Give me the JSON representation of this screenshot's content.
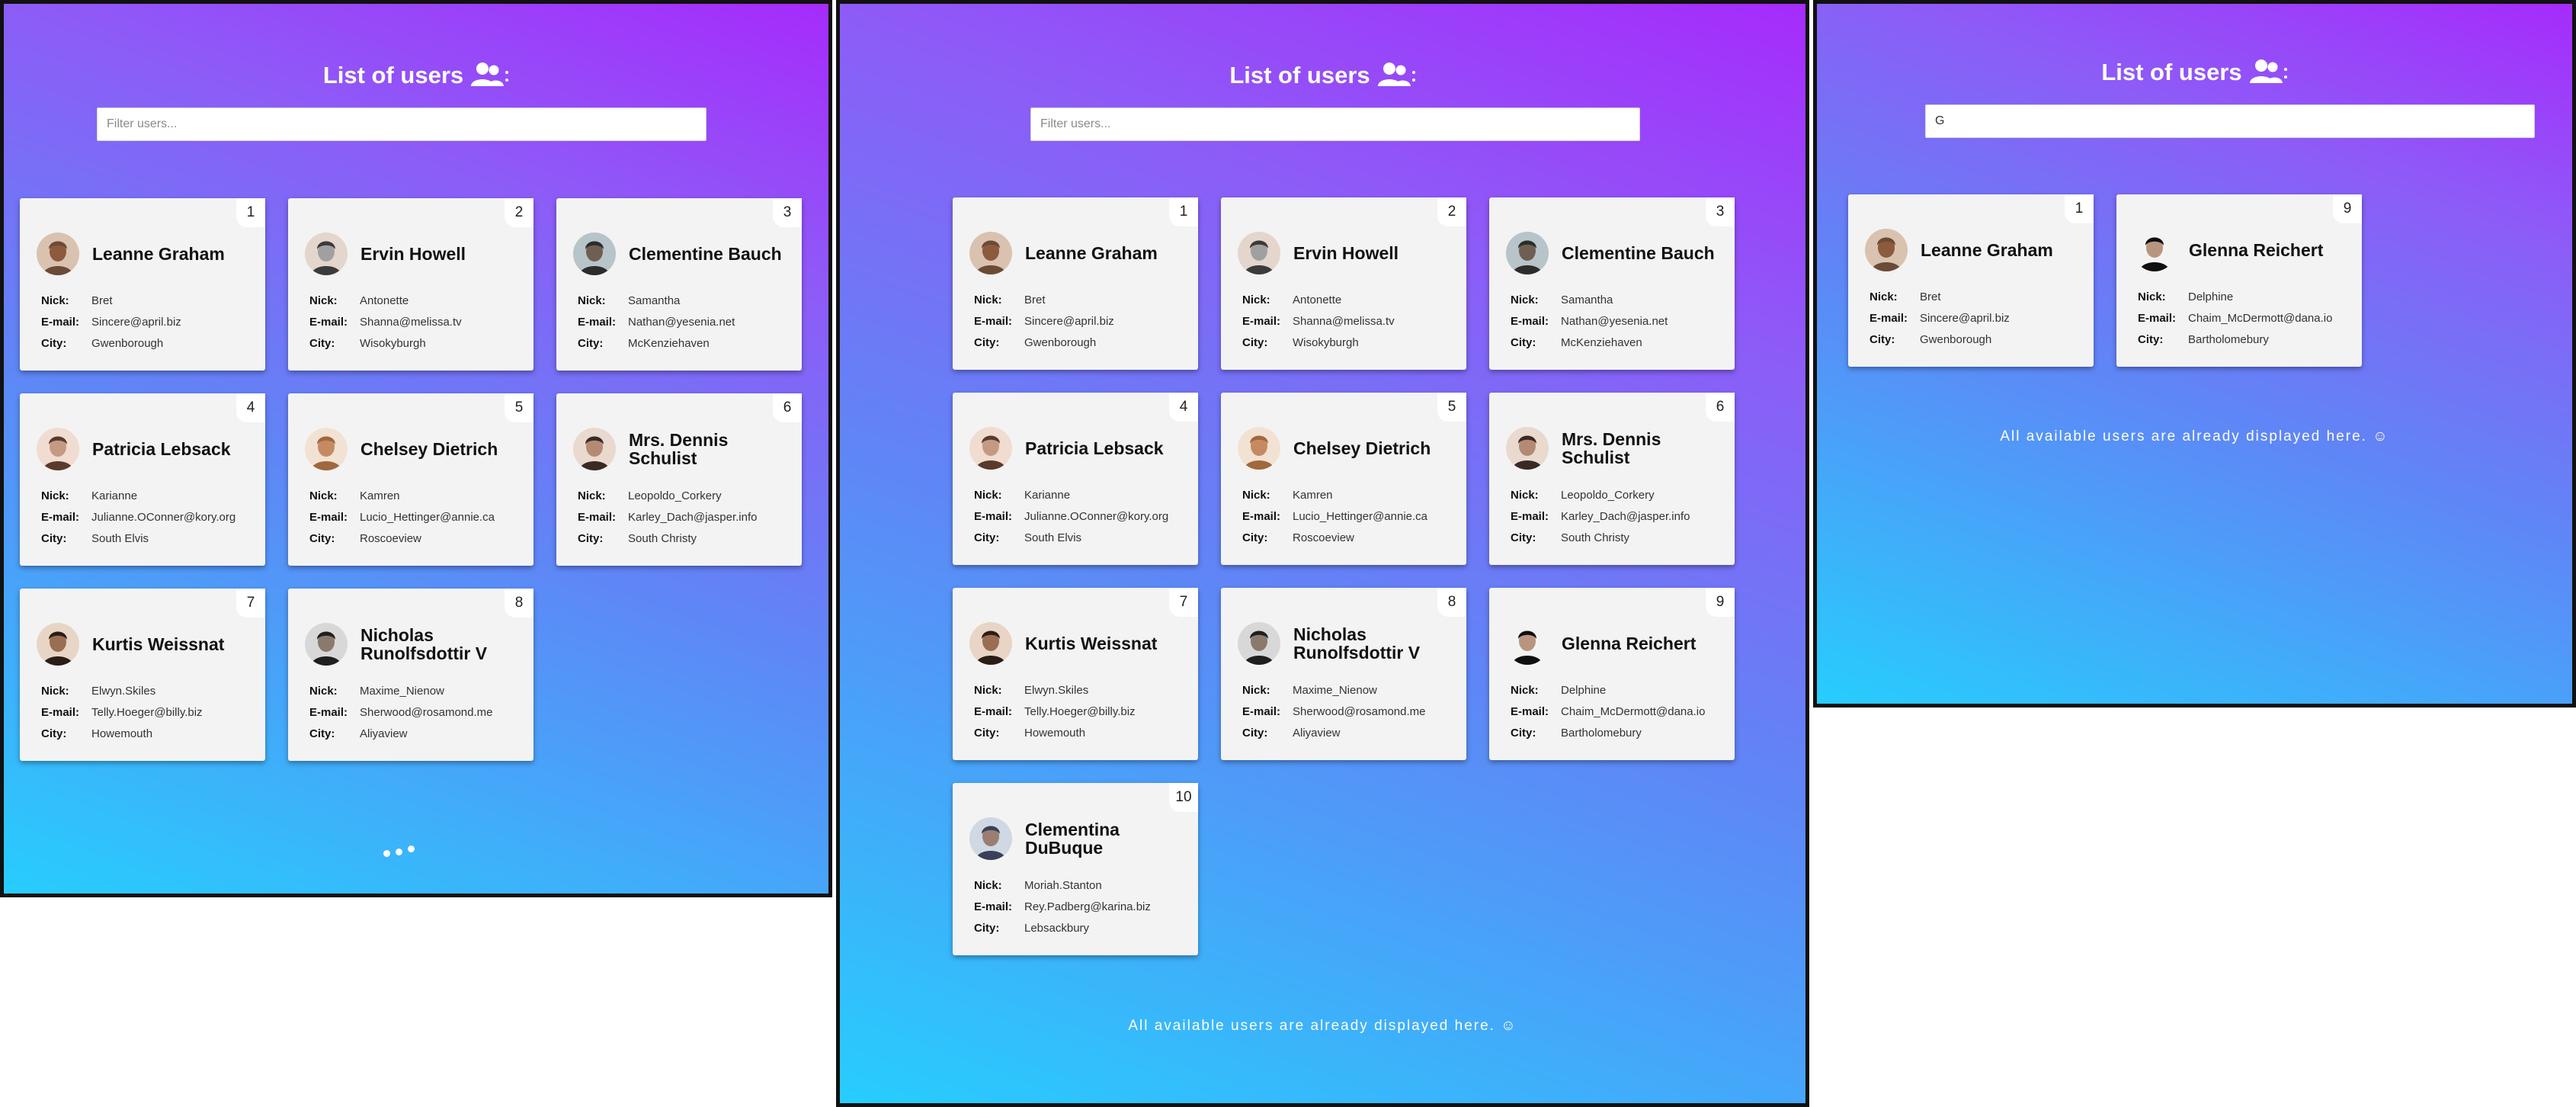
{
  "panels": [
    {
      "title": "List of users",
      "search": {
        "placeholder": "Filter users...",
        "value": ""
      },
      "cards": [
        {
          "id": "1",
          "name": "Leanne Graham",
          "nick": "Bret",
          "email": "Sincere@april.biz",
          "city": "Gwenborough"
        },
        {
          "id": "2",
          "name": "Ervin Howell",
          "nick": "Antonette",
          "email": "Shanna@melissa.tv",
          "city": "Wisokyburgh"
        },
        {
          "id": "3",
          "name": "Clementine Bauch",
          "nick": "Samantha",
          "email": "Nathan@yesenia.net",
          "city": "McKenziehaven"
        },
        {
          "id": "4",
          "name": "Patricia Lebsack",
          "nick": "Karianne",
          "email": "Julianne.OConner@kory.org",
          "city": "South Elvis"
        },
        {
          "id": "5",
          "name": "Chelsey Dietrich",
          "nick": "Kamren",
          "email": "Lucio_Hettinger@annie.ca",
          "city": "Roscoeview"
        },
        {
          "id": "6",
          "name": "Mrs. Dennis Schulist",
          "nick": "Leopoldo_Corkery",
          "email": "Karley_Dach@jasper.info",
          "city": "South Christy"
        },
        {
          "id": "7",
          "name": "Kurtis Weissnat",
          "nick": "Elwyn.Skiles",
          "email": "Telly.Hoeger@billy.biz",
          "city": "Howemouth"
        },
        {
          "id": "8",
          "name": "Nicholas Runolfsdottir V",
          "nick": "Maxime_Nienow",
          "email": "Sherwood@rosamond.me",
          "city": "Aliyaview"
        }
      ],
      "footer": ""
    },
    {
      "title": "List of users",
      "search": {
        "placeholder": "Filter users...",
        "value": ""
      },
      "cards": [
        {
          "id": "1",
          "name": "Leanne Graham",
          "nick": "Bret",
          "email": "Sincere@april.biz",
          "city": "Gwenborough"
        },
        {
          "id": "2",
          "name": "Ervin Howell",
          "nick": "Antonette",
          "email": "Shanna@melissa.tv",
          "city": "Wisokyburgh"
        },
        {
          "id": "3",
          "name": "Clementine Bauch",
          "nick": "Samantha",
          "email": "Nathan@yesenia.net",
          "city": "McKenziehaven"
        },
        {
          "id": "4",
          "name": "Patricia Lebsack",
          "nick": "Karianne",
          "email": "Julianne.OConner@kory.org",
          "city": "South Elvis"
        },
        {
          "id": "5",
          "name": "Chelsey Dietrich",
          "nick": "Kamren",
          "email": "Lucio_Hettinger@annie.ca",
          "city": "Roscoeview"
        },
        {
          "id": "6",
          "name": "Mrs. Dennis Schulist",
          "nick": "Leopoldo_Corkery",
          "email": "Karley_Dach@jasper.info",
          "city": "South Christy"
        },
        {
          "id": "7",
          "name": "Kurtis Weissnat",
          "nick": "Elwyn.Skiles",
          "email": "Telly.Hoeger@billy.biz",
          "city": "Howemouth"
        },
        {
          "id": "8",
          "name": "Nicholas Runolfsdottir V",
          "nick": "Maxime_Nienow",
          "email": "Sherwood@rosamond.me",
          "city": "Aliyaview"
        },
        {
          "id": "9",
          "name": "Glenna Reichert",
          "nick": "Delphine",
          "email": "Chaim_McDermott@dana.io",
          "city": "Bartholomebury"
        },
        {
          "id": "10",
          "name": "Clementina DuBuque",
          "nick": "Moriah.Stanton",
          "email": "Rey.Padberg@karina.biz",
          "city": "Lebsackbury"
        }
      ],
      "footer": "All available users are already displayed here. ☺"
    },
    {
      "title": "List of users",
      "search": {
        "placeholder": "Filter users...",
        "value": "G"
      },
      "cards": [
        {
          "id": "1",
          "name": "Leanne Graham",
          "nick": "Bret",
          "email": "Sincere@april.biz",
          "city": "Gwenborough"
        },
        {
          "id": "9",
          "name": "Glenna Reichert",
          "nick": "Delphine",
          "email": "Chaim_McDermott@dana.io",
          "city": "Bartholomebury"
        }
      ],
      "footer": "All available users are already displayed here. ☺"
    }
  ],
  "labels": {
    "nick": "Nick:",
    "email": "E-mail:",
    "city": "City:"
  },
  "icons": {
    "users": "users-icon",
    "loading": "loading-dots-icon"
  },
  "colors": {
    "gradient_start": "#27cdfd",
    "gradient_end": "#a62bfb",
    "card_bg": "#f3f3f3"
  }
}
